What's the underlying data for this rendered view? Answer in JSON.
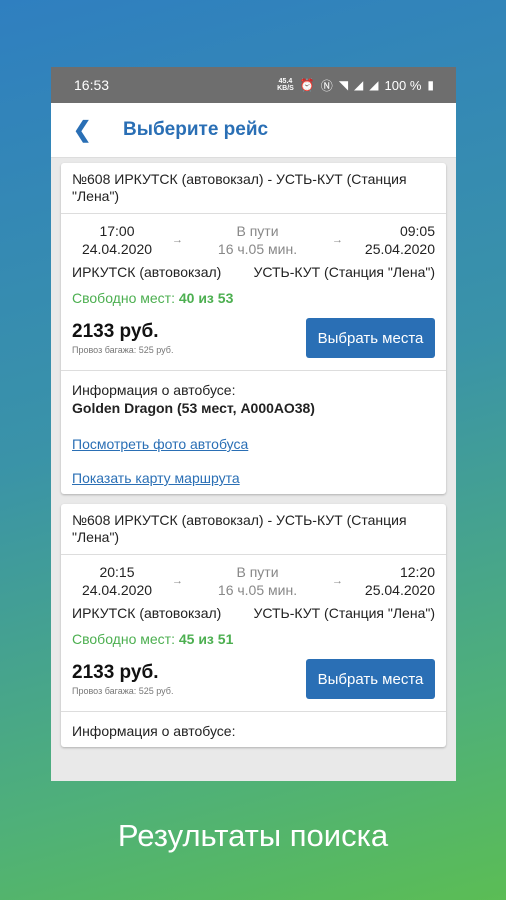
{
  "status": {
    "time": "16:53",
    "speed_value": "45.4",
    "speed_unit": "KB/S",
    "battery": "100 %"
  },
  "header": {
    "title": "Выберите рейс"
  },
  "trips": [
    {
      "route": "№608 ИРКУТСК (автовокзал) - УСТЬ-КУТ (Станция \"Лена\")",
      "dep_time": "17:00",
      "dep_date": "24.04.2020",
      "in_transit": "В пути",
      "duration": "16 ч.05 мин.",
      "arr_time": "09:05",
      "arr_date": "25.04.2020",
      "from": "ИРКУТСК (автовокзал)",
      "to": "УСТЬ-КУТ (Станция \"Лена\")",
      "free_label": "Свободно мест:",
      "free_value": "40 из 53",
      "price": "2133 руб.",
      "baggage": "Провоз багажа: 525 руб.",
      "select_label": "Выбрать места",
      "bus_info_label": "Информация о автобусе:",
      "bus_name": "Golden Dragon (53 мест, А000АО38)",
      "photo_link": "Посмотреть фото автобуса",
      "map_link": "Показать карту маршрута"
    },
    {
      "route": "№608 ИРКУТСК (автовокзал) - УСТЬ-КУТ (Станция \"Лена\")",
      "dep_time": "20:15",
      "dep_date": "24.04.2020",
      "in_transit": "В пути",
      "duration": "16 ч.05 мин.",
      "arr_time": "12:20",
      "arr_date": "25.04.2020",
      "from": "ИРКУТСК (автовокзал)",
      "to": "УСТЬ-КУТ (Станция \"Лена\")",
      "free_label": "Свободно мест:",
      "free_value": "45 из 51",
      "price": "2133 руб.",
      "baggage": "Провоз багажа: 525 руб.",
      "select_label": "Выбрать места",
      "bus_info_label": "Информация о автобусе:"
    }
  ],
  "caption": "Результаты поиска",
  "colors": {
    "accent": "#2a6fb5",
    "free": "#4caf50"
  }
}
